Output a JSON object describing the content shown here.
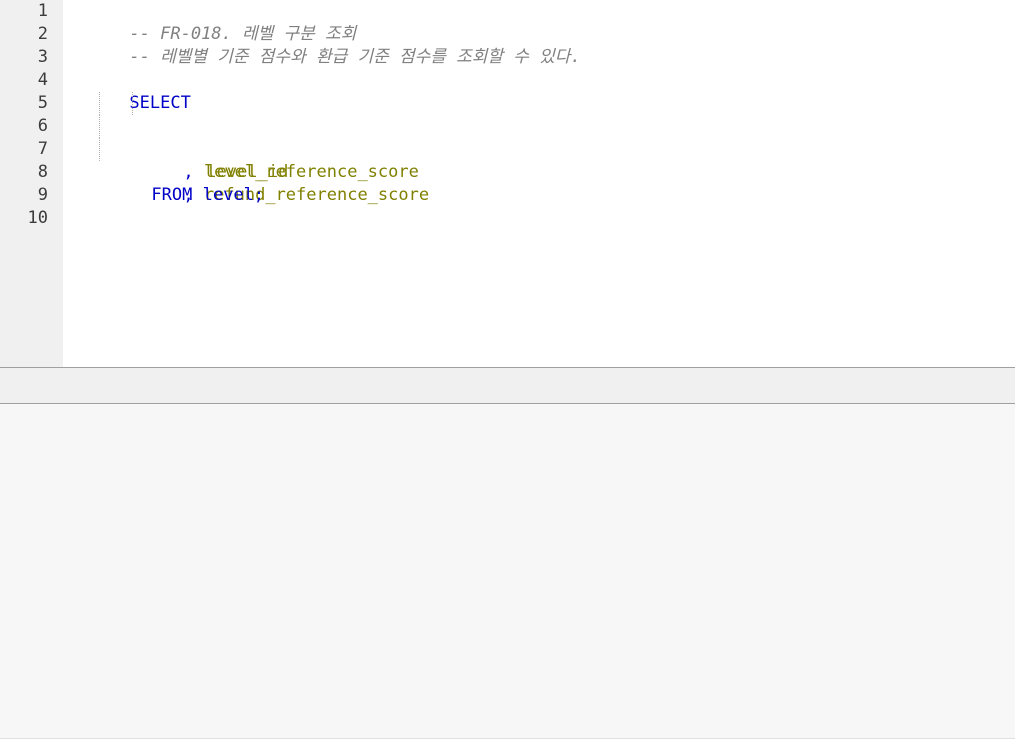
{
  "editor": {
    "line_numbers": [
      "1",
      "2",
      "3",
      "4",
      "5",
      "6",
      "7",
      "8",
      "9",
      "10"
    ],
    "lines": {
      "l1": "-- FR-018. 레벨 구분 조회",
      "l2": "-- 레벨별 기준 점수와 환급 기준 점수를 조회할 수 있다.",
      "l4_kw": "SELECT",
      "l5_col": "level_id",
      "l6_comma": ",",
      "l6_col": "level_reference_score",
      "l7_comma": ",",
      "l7_col": "refund_reference_score",
      "l8_kw": "FROM",
      "l8_table": "level;"
    },
    "colors": {
      "comment": "#808080",
      "keyword": "#0000c8",
      "identifier": "#808000",
      "gutter_bg": "#f0f0f0",
      "result_bg": "#f7f7f7"
    }
  }
}
